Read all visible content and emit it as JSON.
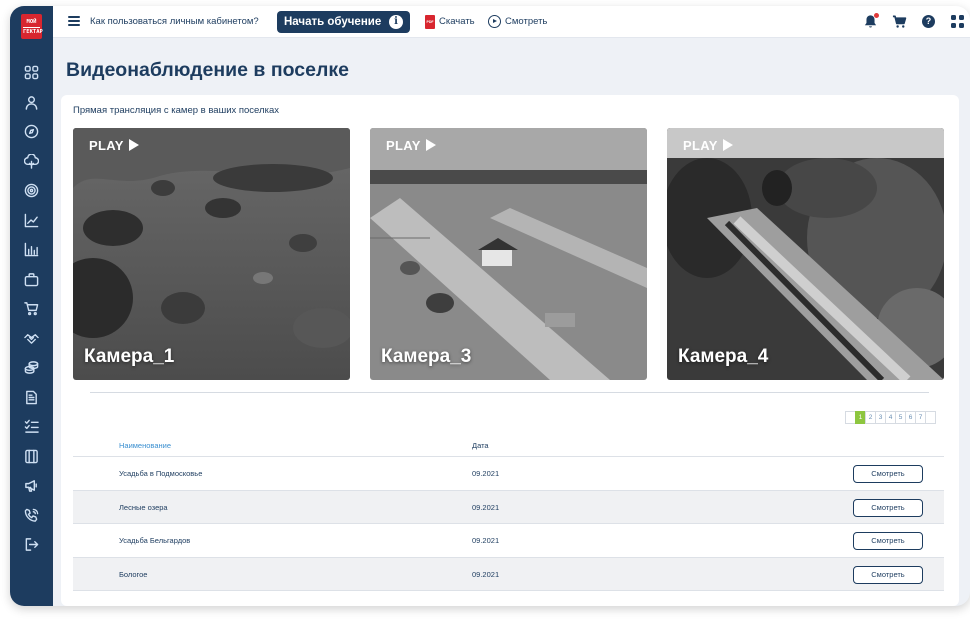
{
  "logo": {
    "line1": "МОЙ",
    "line2": "ГЕКТАР"
  },
  "sidebar": {
    "items": [
      {
        "icon": "dashboard-grid-icon"
      },
      {
        "icon": "user-icon"
      },
      {
        "icon": "compass-icon"
      },
      {
        "icon": "tree-icon"
      },
      {
        "icon": "target-icon"
      },
      {
        "icon": "chart-line-icon"
      },
      {
        "icon": "chart-bar-icon"
      },
      {
        "icon": "briefcase-icon"
      },
      {
        "icon": "cart-icon"
      },
      {
        "icon": "handshake-icon"
      },
      {
        "icon": "coins-icon"
      },
      {
        "icon": "document-icon"
      },
      {
        "icon": "checklist-icon"
      },
      {
        "icon": "book-icon"
      },
      {
        "icon": "megaphone-icon"
      },
      {
        "icon": "phone-icon"
      },
      {
        "icon": "logout-icon"
      }
    ]
  },
  "topbar": {
    "help_link": "Как пользоваться личным кабинетом?",
    "start_button": "Начать обучение",
    "info_glyph": "i",
    "pdf_badge": "PDF",
    "download": "Скачать",
    "watch": "Смотреть",
    "help_glyph": "?",
    "accent_red": "#d8262f"
  },
  "page": {
    "title": "Видеонаблюдение в поселке",
    "subtitle": "Прямая трансляция с камер в ваших поселках"
  },
  "cameras": [
    {
      "play": "PLAY",
      "name": "Камера_1"
    },
    {
      "play": "PLAY",
      "name": "Камера_3"
    },
    {
      "play": "PLAY",
      "name": "Камера_4"
    }
  ],
  "pagination": {
    "pages": [
      "1",
      "2",
      "3",
      "4",
      "5",
      "6",
      "7"
    ],
    "current": "1"
  },
  "table": {
    "columns": {
      "name": "Наименование",
      "date": "Дата"
    },
    "rows": [
      {
        "name": "Усадьба в Подмосковье",
        "date": "09.2021",
        "action": "Смотреть"
      },
      {
        "name": "Лесные озера",
        "date": "09.2021",
        "action": "Смотреть"
      },
      {
        "name": "Усадьба Бельгардов",
        "date": "09.2021",
        "action": "Смотреть"
      },
      {
        "name": "Бологое",
        "date": "09.2021",
        "action": "Смотреть"
      }
    ]
  },
  "colors": {
    "brand_navy": "#1d3c5f",
    "active_page": "#8dc63f",
    "link_blue": "#3a8fd0"
  }
}
